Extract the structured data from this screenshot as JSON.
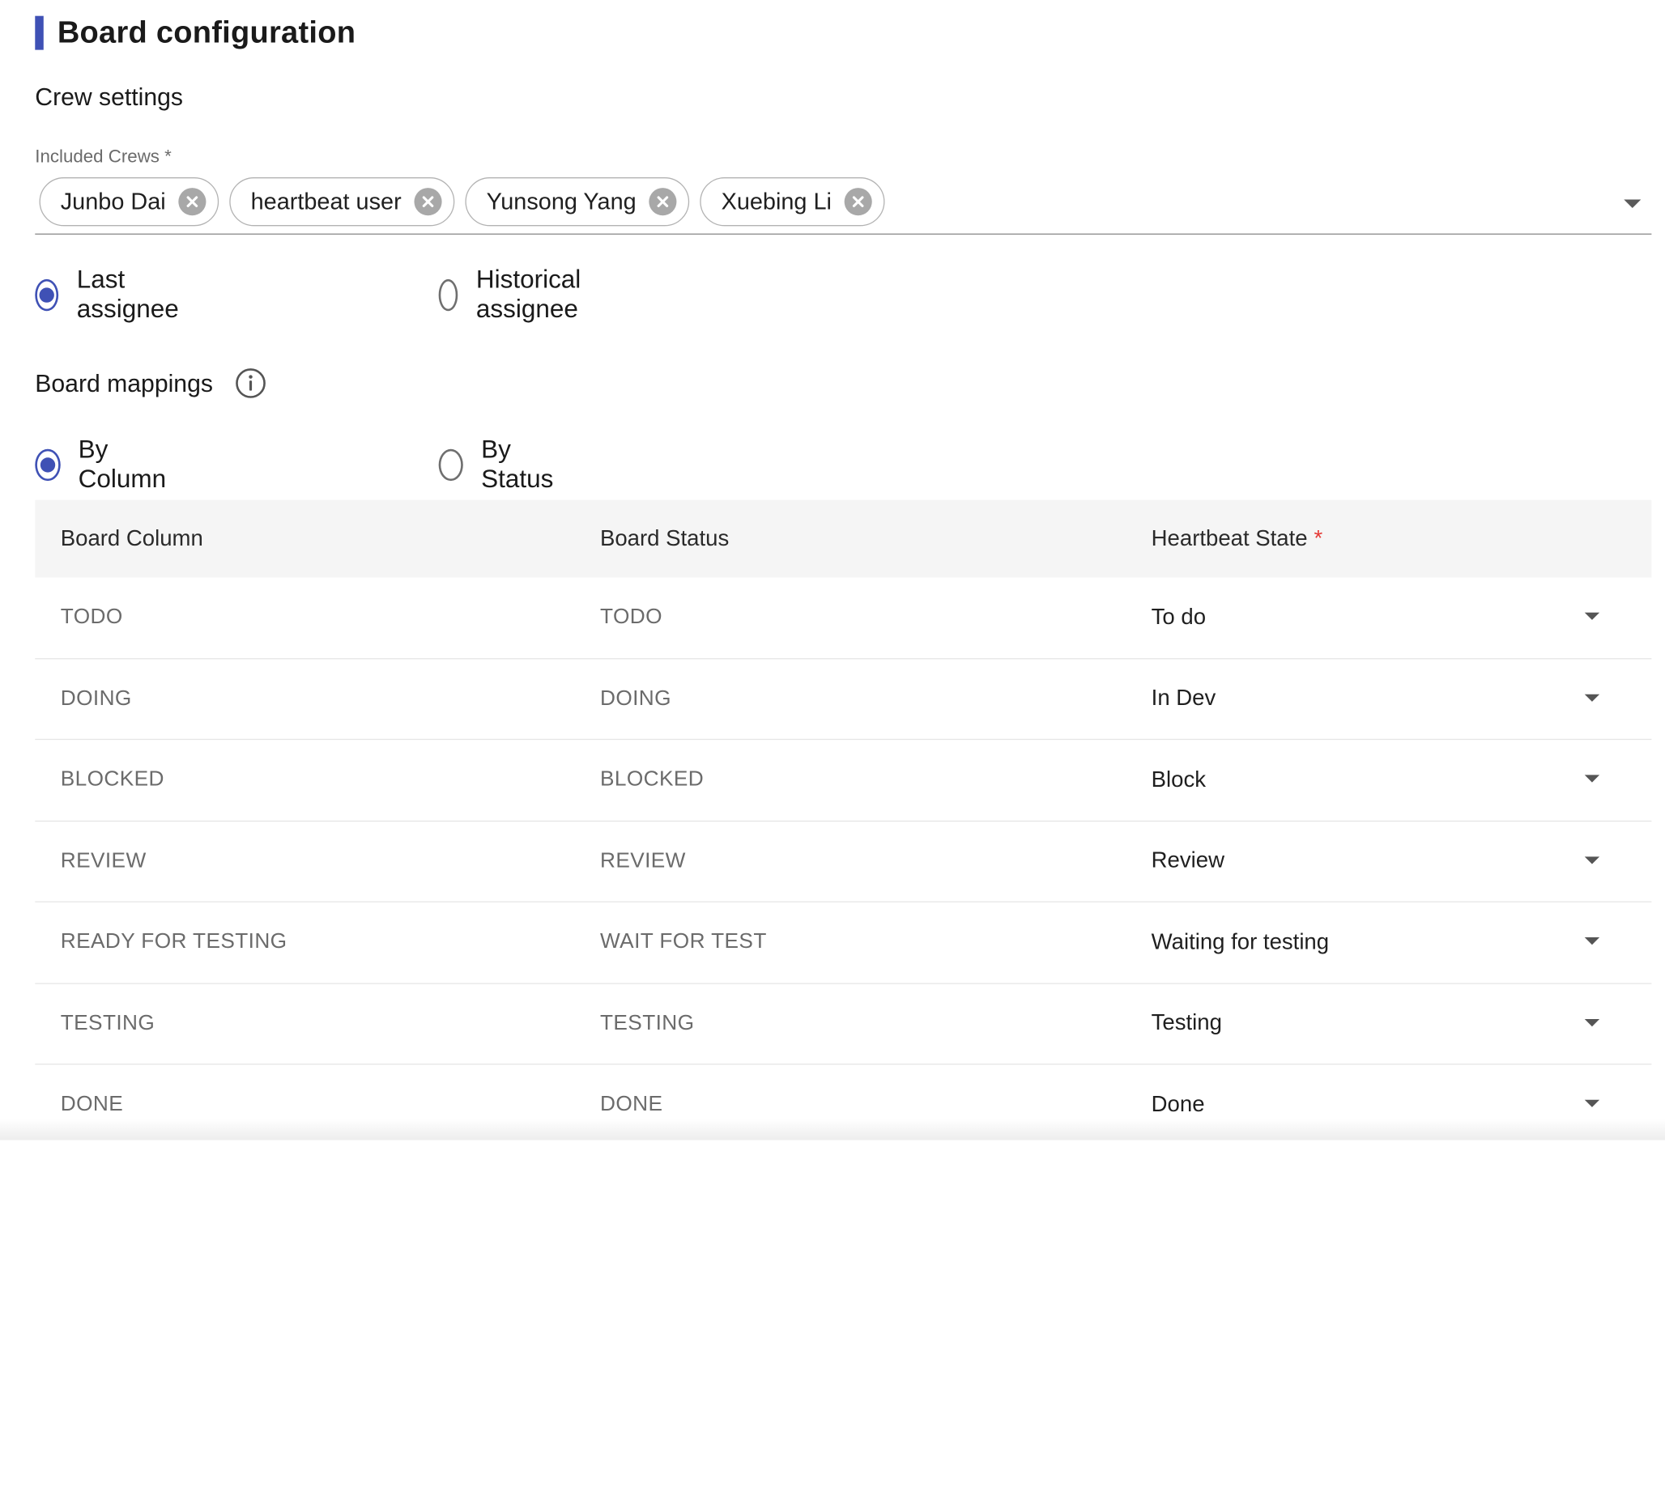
{
  "page": {
    "title": "Board configuration"
  },
  "crew_settings": {
    "heading": "Crew settings",
    "field_label": "Included Crews *",
    "chips": [
      "Junbo Dai",
      "heartbeat user",
      "Yunsong Yang",
      "Xuebing Li"
    ],
    "assignee_options": [
      {
        "label": "Last assignee",
        "checked": true
      },
      {
        "label": "Historical assignee",
        "checked": false
      }
    ]
  },
  "board_mappings": {
    "heading": "Board mappings",
    "mode_options": [
      {
        "label": "By Column",
        "checked": true
      },
      {
        "label": "By Status",
        "checked": false
      }
    ],
    "table": {
      "headers": {
        "column": "Board Column",
        "status": "Board Status",
        "state": "Heartbeat State",
        "required_mark": "*"
      },
      "rows": [
        {
          "column": "TODO",
          "status": "TODO",
          "state": "To do"
        },
        {
          "column": "DOING",
          "status": "DOING",
          "state": "In Dev"
        },
        {
          "column": "BLOCKED",
          "status": "BLOCKED",
          "state": "Block"
        },
        {
          "column": "REVIEW",
          "status": "REVIEW",
          "state": "Review"
        },
        {
          "column": "READY FOR TESTING",
          "status": "WAIT FOR TEST",
          "state": "Waiting for testing"
        },
        {
          "column": "TESTING",
          "status": "TESTING",
          "state": "Testing"
        },
        {
          "column": "DONE",
          "status": "DONE",
          "state": "Done"
        }
      ]
    }
  },
  "colors": {
    "accent": "#3f51b5",
    "required": "#e53935",
    "header_bg": "#f5f5f5"
  }
}
